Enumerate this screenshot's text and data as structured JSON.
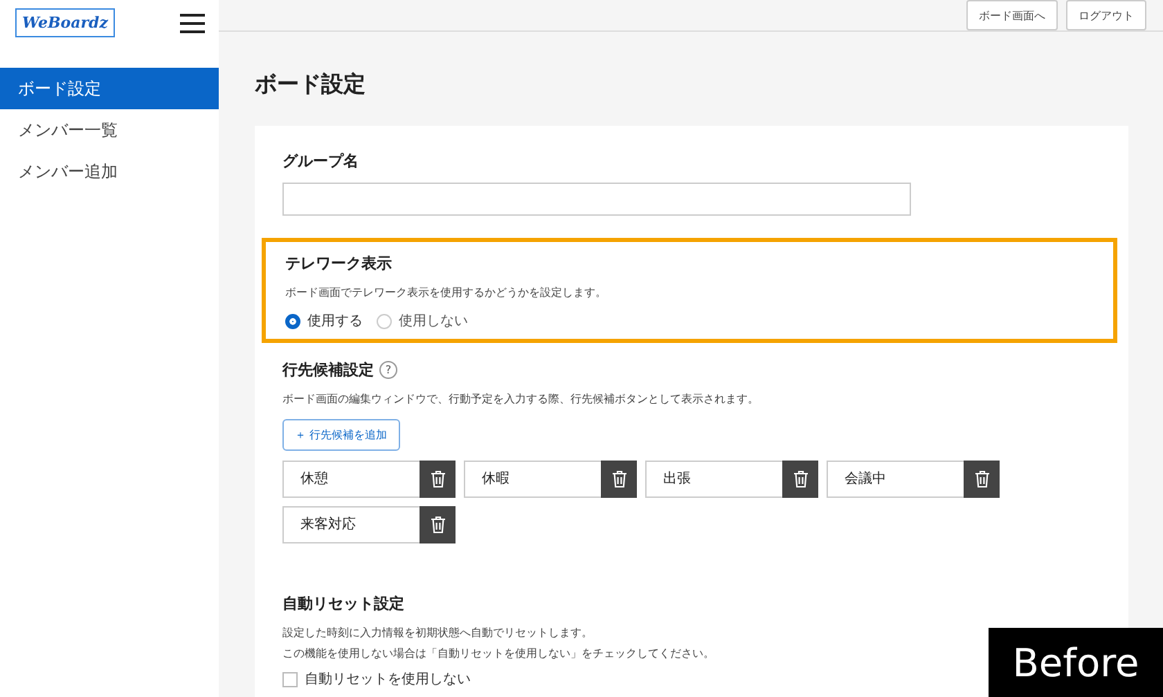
{
  "logo": {
    "text": "WeBoardz"
  },
  "header": {
    "buttons": [
      "ボード画面へ",
      "ログアウト"
    ]
  },
  "sidebar": {
    "items": [
      {
        "label": "ボード設定",
        "selected": true
      },
      {
        "label": "メンバー一覧",
        "selected": false
      },
      {
        "label": "メンバー追加",
        "selected": false
      }
    ]
  },
  "page_title": "ボード設定",
  "group_name": {
    "label": "グループ名"
  },
  "telework": {
    "title": "テレワーク表示",
    "description": "ボード画面でテレワーク表示を使用するかどうかを設定します。",
    "highlighted": true,
    "options": [
      {
        "label": "使用する",
        "selected": true
      },
      {
        "label": "使用しない",
        "selected": false
      }
    ]
  },
  "destinations": {
    "title": "行先候補設定",
    "help": "?",
    "description": "ボード画面の編集ウィンドウで、行動予定を入力する際、行先候補ボタンとして表示されます。",
    "add_button": "＋ 行先候補を追加",
    "items": [
      "休憩",
      "休暇",
      "出張",
      "会議中",
      "来客対応"
    ]
  },
  "auto_reset": {
    "title": "自動リセット設定",
    "description": [
      "設定した時刻に入力情報を初期状態へ自動でリセットします。",
      "この機能を使用しない場合は「自動リセットを使用しない」をチェックしてください。"
    ],
    "checkbox": {
      "label": "自動リセットを使用しない",
      "checked": false
    }
  },
  "corner_label": "Before"
}
